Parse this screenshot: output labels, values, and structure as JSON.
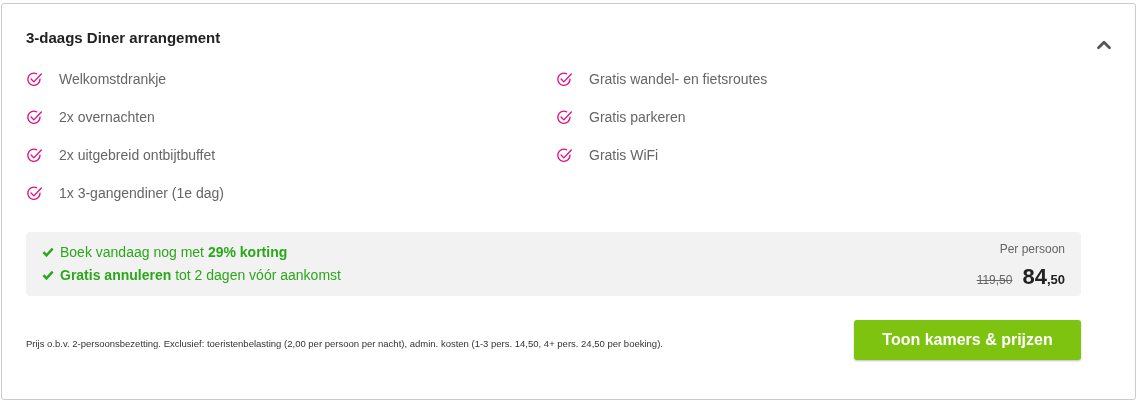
{
  "card": {
    "title": "3-daags Diner arrangement",
    "expanded": true,
    "features_left": [
      "Welkomstdrankje",
      "2x overnachten",
      "2x uitgebreid ontbijtbuffet",
      "1x 3-gangendiner (1e dag)"
    ],
    "features_right": [
      "Gratis wandel- en fietsroutes",
      "Gratis parkeren",
      "Gratis WiFi"
    ],
    "promo": {
      "lines": [
        "Boek vandaag nog met **29% korting**",
        "**Gratis annuleren** tot 2 dagen vóór aankomst"
      ],
      "price_label": "Per persoon",
      "old_price": "119,50",
      "price_whole": "84",
      "price_cents": ",50"
    },
    "footnote": "Prijs o.b.v. 2-persoonsbezetting. Exclusief: toeristenbelasting (2,00 per persoon per nacht), admin. kosten (1-3 pers. 14,50, 4+ pers. 24,50 per boeking).",
    "button": "Toon kamers & prijzen"
  }
}
